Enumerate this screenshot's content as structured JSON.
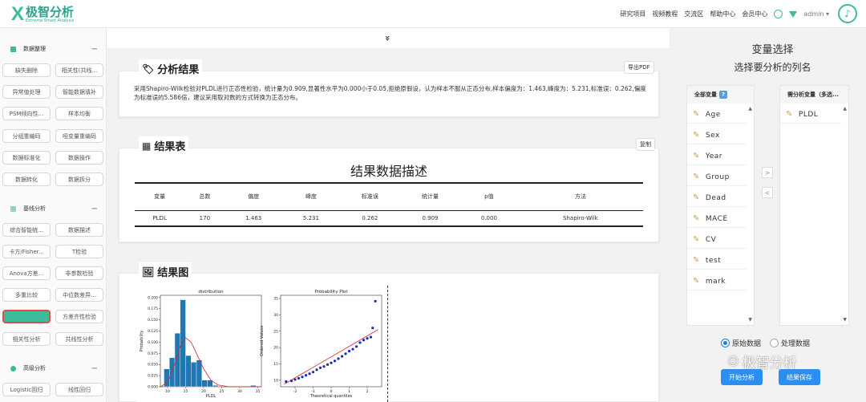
{
  "header": {
    "logo_cn": "极智分析",
    "logo_en": "Extreme Smart Analysis",
    "nav": [
      "研究项目",
      "视频教程",
      "交流区",
      "帮助中心",
      "会员中心"
    ],
    "admin": "admin ▾"
  },
  "sidebar": {
    "sections": [
      {
        "title": "数据整理",
        "color": "#3dbb9a"
      },
      {
        "title": "基线分析",
        "color": "#8fd3c1"
      },
      {
        "title": "高级分析",
        "color": "#3dbb9a"
      }
    ],
    "items": [
      "缺失删除",
      "相关性(共线...",
      "异常值处理",
      "智能数据填补",
      "PSM倾向性...",
      "样本均衡",
      "分组重编码",
      "哑变量重编码",
      "数据标准化",
      "数据操作",
      "数据转化",
      "数据拆分",
      "综合智能统...",
      "数据描述",
      "卡方/Fisher...",
      "T检验",
      "Anova方差...",
      "非参数检验",
      "多重比较",
      "中位数差异...",
      "正态性检验",
      "方差齐性检验",
      "相关性分析",
      "共线性分析",
      "Logistic回归",
      "线性回归"
    ]
  },
  "main": {
    "collapse_icon": "»",
    "analysis": {
      "title": "分析结果",
      "export": "导出PDF",
      "text": "采用Shapiro-Wilk检验对PLDL进行正态性检验，统计量为0.909,显著性水平为0.000小于0.05,拒绝原假设，认为样本不服从正态分布,样本偏度为：1.463,峰度为：5.231,标准误：0.262,偏度为标准误的5.586倍，建议采用取对数的方式转换为正态分布。"
    },
    "table": {
      "title": "结果表",
      "copy": "复制",
      "heading": "结果数据描述",
      "columns": [
        "变量",
        "总数",
        "偏度",
        "峰度",
        "标准误",
        "统计量",
        "p值",
        "方法"
      ],
      "rows": [
        [
          "PLDL",
          "170",
          "1.463",
          "5.231",
          "0.262",
          "0.909",
          "0.000",
          "Shapiro-Wilk"
        ]
      ]
    },
    "plots_title": "结果图"
  },
  "chart_data": [
    {
      "type": "bar",
      "title": "distribution",
      "xlabel": "PLDL",
      "ylabel": "Probability",
      "x_ticks": [
        "10",
        "15",
        "20",
        "25",
        "30",
        "35"
      ],
      "y_ticks": [
        "0.000",
        "0.025",
        "0.050",
        "0.075",
        "0.100",
        "0.125",
        "0.150",
        "0.175",
        "0.200"
      ],
      "xlim": [
        8,
        36
      ],
      "ylim": [
        0,
        0.205
      ],
      "bin_edges": [
        9,
        10.5,
        12,
        13.5,
        15,
        16.5,
        18,
        19.5,
        21,
        22.5,
        24,
        25.5,
        27,
        28.5,
        30,
        31.5,
        33,
        34.5
      ],
      "values": [
        0.04,
        0.065,
        0.12,
        0.195,
        0.07,
        0.055,
        0.06,
        0.015,
        0.015,
        0.003,
        0.0,
        0.0,
        0.0,
        0.0,
        0.0,
        0.0,
        0.003
      ],
      "kde": [
        [
          8,
          0.0
        ],
        [
          10,
          0.01
        ],
        [
          12,
          0.05
        ],
        [
          13.5,
          0.09
        ],
        [
          15,
          0.11
        ],
        [
          16.5,
          0.1
        ],
        [
          18,
          0.075
        ],
        [
          20,
          0.04
        ],
        [
          22,
          0.015
        ],
        [
          24,
          0.004
        ],
        [
          27,
          0.0
        ],
        [
          36,
          0.0
        ]
      ],
      "colors": {
        "bar": "#1f77b4",
        "kde": "#d62728"
      }
    },
    {
      "type": "scatter",
      "title": "Probability Plot",
      "xlabel": "Theoretical quantiles",
      "ylabel": "Ordered Values",
      "x_ticks": [
        "-2",
        "-1",
        "0",
        "1",
        "2"
      ],
      "y_ticks": [
        "10",
        "15",
        "20",
        "25",
        "30",
        "35"
      ],
      "xlim": [
        -2.8,
        2.8
      ],
      "ylim": [
        8,
        36
      ],
      "fit_line": [
        [
          -2.6,
          8.8
        ],
        [
          2.6,
          25.5
        ]
      ],
      "points": [
        [
          -2.5,
          9.6
        ],
        [
          -2.2,
          9.8
        ],
        [
          -2.0,
          10.2
        ],
        [
          -1.8,
          10.6
        ],
        [
          -1.6,
          11.0
        ],
        [
          -1.4,
          11.5
        ],
        [
          -1.2,
          12.0
        ],
        [
          -1.0,
          12.5
        ],
        [
          -0.8,
          13.2
        ],
        [
          -0.6,
          13.8
        ],
        [
          -0.4,
          14.2
        ],
        [
          -0.2,
          14.8
        ],
        [
          0.0,
          15.3
        ],
        [
          0.2,
          15.9
        ],
        [
          0.4,
          16.6
        ],
        [
          0.6,
          17.3
        ],
        [
          0.8,
          18.1
        ],
        [
          1.0,
          18.9
        ],
        [
          1.2,
          19.5
        ],
        [
          1.4,
          20.3
        ],
        [
          1.6,
          21.5
        ],
        [
          1.8,
          22.3
        ],
        [
          2.0,
          22.8
        ],
        [
          2.2,
          23.2
        ],
        [
          2.3,
          26.0
        ],
        [
          2.45,
          34.2
        ]
      ],
      "colors": {
        "point": "#1f2bb4",
        "line": "#d62728"
      }
    }
  ],
  "right_panel": {
    "title": "变量选择",
    "subtitle": "选择要分析的列名",
    "all_vars_header": "全部变量",
    "all_vars_help": "?",
    "selected_header": "需分析变量（多选...",
    "variables": [
      "Age",
      "Sex",
      "Year",
      "Group",
      "Dead",
      "MACE",
      "CV",
      "test",
      "mark"
    ],
    "selected": [
      "PLDL"
    ],
    "move_right": ">",
    "move_left": "<",
    "radio_raw": "原始数据",
    "radio_processed": "处理数据",
    "start_btn": "开始分析",
    "save_btn": "结果保存",
    "watermark": "极智分析"
  }
}
